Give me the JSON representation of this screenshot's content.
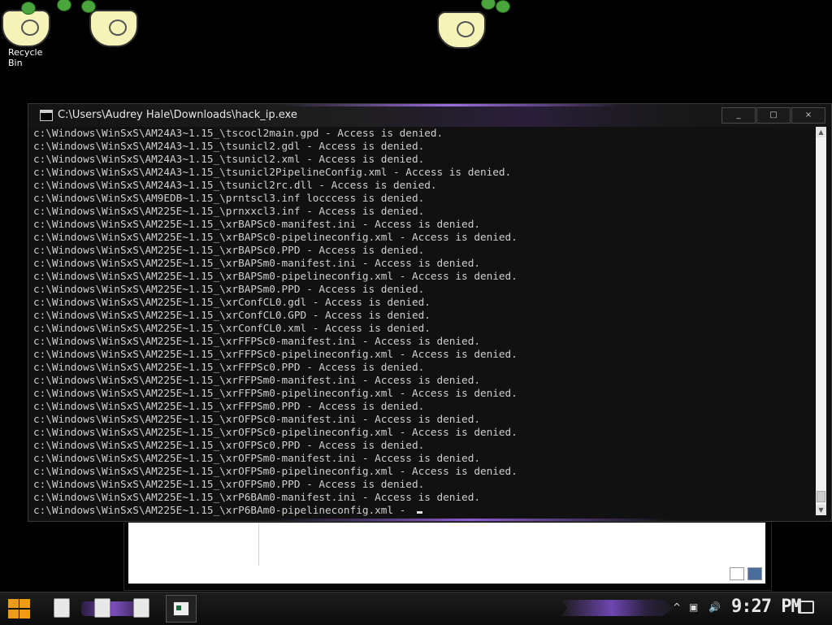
{
  "desktop": {
    "recycle_bin_label": "Recycle Bin"
  },
  "cmd_window": {
    "title": "C:\\Users\\Audrey Hale\\Downloads\\hack_ip.exe",
    "minimize_glyph": "_",
    "maximize_glyph": "□",
    "close_glyph": "×",
    "lines": [
      "c:\\Windows\\WinSxS\\AM24A3~1.15_\\tscocl2main.gpd - Access is denied.",
      "c:\\Windows\\WinSxS\\AM24A3~1.15_\\tsunicl2.gdl - Access is denied.",
      "c:\\Windows\\WinSxS\\AM24A3~1.15_\\tsunicl2.xml - Access is denied.",
      "c:\\Windows\\WinSxS\\AM24A3~1.15_\\tsunicl2PipelineConfig.xml - Access is denied.",
      "c:\\Windows\\WinSxS\\AM24A3~1.15_\\tsunicl2rc.dll - Access is denied.",
      "c:\\Windows\\WinSxS\\AM9EDB~1.15_\\prntscl3.inf locccess is denied.",
      "c:\\Windows\\WinSxS\\AM225E~1.15_\\prnxxcl3.inf - Access is denied.",
      "c:\\Windows\\WinSxS\\AM225E~1.15_\\xrBAPSc0-manifest.ini - Access is denied.",
      "c:\\Windows\\WinSxS\\AM225E~1.15_\\xrBAPSc0-pipelineconfig.xml - Access is denied.",
      "c:\\Windows\\WinSxS\\AM225E~1.15_\\xrBAPSc0.PPD - Access is denied.",
      "c:\\Windows\\WinSxS\\AM225E~1.15_\\xrBAPSm0-manifest.ini - Access is denied.",
      "c:\\Windows\\WinSxS\\AM225E~1.15_\\xrBAPSm0-pipelineconfig.xml - Access is denied.",
      "c:\\Windows\\WinSxS\\AM225E~1.15_\\xrBAPSm0.PPD - Access is denied.",
      "c:\\Windows\\WinSxS\\AM225E~1.15_\\xrConfCL0.gdl - Access is denied.",
      "c:\\Windows\\WinSxS\\AM225E~1.15_\\xrConfCL0.GPD - Access is denied.",
      "c:\\Windows\\WinSxS\\AM225E~1.15_\\xrConfCL0.xml - Access is denied.",
      "c:\\Windows\\WinSxS\\AM225E~1.15_\\xrFFPSc0-manifest.ini - Access is denied.",
      "c:\\Windows\\WinSxS\\AM225E~1.15_\\xrFFPSc0-pipelineconfig.xml - Access is denied.",
      "c:\\Windows\\WinSxS\\AM225E~1.15_\\xrFFPSc0.PPD - Access is denied.",
      "c:\\Windows\\WinSxS\\AM225E~1.15_\\xrFFPSm0-manifest.ini - Access is denied.",
      "c:\\Windows\\WinSxS\\AM225E~1.15_\\xrFFPSm0-pipelineconfig.xml - Access is denied.",
      "c:\\Windows\\WinSxS\\AM225E~1.15_\\xrFFPSm0.PPD - Access is denied.",
      "c:\\Windows\\WinSxS\\AM225E~1.15_\\xrOFPSc0-manifest.ini - Access is denied.",
      "c:\\Windows\\WinSxS\\AM225E~1.15_\\xrOFPSc0-pipelineconfig.xml - Access is denied.",
      "c:\\Windows\\WinSxS\\AM225E~1.15_\\xrOFPSc0.PPD - Access is denied.",
      "c:\\Windows\\WinSxS\\AM225E~1.15_\\xrOFPSm0-manifest.ini - Access is denied.",
      "c:\\Windows\\WinSxS\\AM225E~1.15_\\xrOFPSm0-pipelineconfig.xml - Access is denied.",
      "c:\\Windows\\WinSxS\\AM225E~1.15_\\xrOFPSm0.PPD - Access is denied.",
      "c:\\Windows\\WinSxS\\AM225E~1.15_\\xrP6BAm0-manifest.ini - Access is denied.",
      "c:\\Windows\\WinSxS\\AM225E~1.15_\\xrP6BAm0-pipelineconfig.xml - "
    ],
    "scroll_up_glyph": "▲",
    "scroll_down_glyph": "▼"
  },
  "taskbar": {
    "clock": "9:27 PM",
    "accent_color": "#8b5cd0",
    "start_color": "#f09a1a",
    "tray_chevron": "^",
    "tray_network": "▣",
    "tray_volume": "🔊"
  },
  "icons": [
    "recycle-bin-icon",
    "bag-icon",
    "console-icon",
    "start-icon",
    "file-icon",
    "network-icon",
    "volume-icon",
    "notification-icon"
  ]
}
